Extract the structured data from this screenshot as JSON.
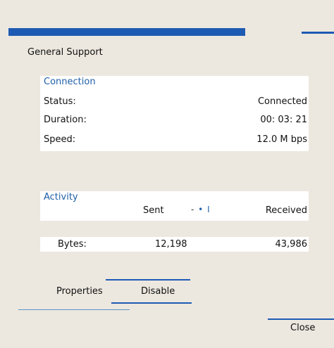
{
  "group": {
    "title": "General Support"
  },
  "connection": {
    "label": "Connection",
    "rows": [
      {
        "label": "Status:",
        "value": "Connected"
      },
      {
        "label": "Duration:",
        "value": "00: 03: 21"
      },
      {
        "label": "Speed:",
        "value": "12.0 M bps"
      }
    ]
  },
  "activity": {
    "label": "Activity",
    "sent_header": "Sent",
    "received_header": "Received",
    "icon_glyph_dash": "-",
    "icon_glyph_dot": "•",
    "icon_glyph_bar": "I",
    "bytes_label": "Bytes:",
    "bytes_sent": "12,198",
    "bytes_received": "43,986"
  },
  "buttons": {
    "properties": "Properties",
    "disable": "Disable",
    "close": "Close"
  },
  "colors": {
    "accent": "#1d5ab4",
    "section_label": "#1f5fa8",
    "background": "#ece8df"
  }
}
